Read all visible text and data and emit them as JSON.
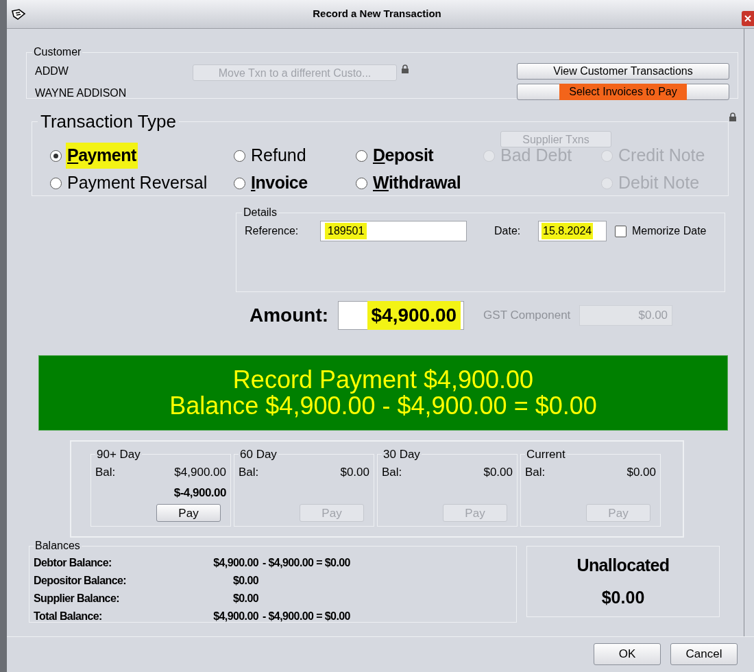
{
  "window": {
    "title": "Record a New Transaction"
  },
  "customer": {
    "legend": "Customer",
    "code": "ADDW",
    "name": "WAYNE ADDISON",
    "move_button": {
      "label": "Move Txn to a different Custo...",
      "disabled": true
    },
    "buttons": [
      {
        "label": "View Customer Transactions",
        "highlighted": false
      },
      {
        "label": "Select Invoices to Pay",
        "highlighted": true
      }
    ]
  },
  "transaction_type": {
    "legend": "Transaction Type",
    "supplier_button": {
      "label": "Supplier Txns",
      "disabled": true
    },
    "columns": [
      [
        {
          "label": "Payment",
          "selected": true,
          "disabled": false,
          "bold": true,
          "accel": true,
          "highlighted": true
        },
        {
          "label": "Payment Reversal",
          "selected": false,
          "disabled": false,
          "bold": false,
          "accel": false,
          "highlighted": false
        }
      ],
      [
        {
          "label": "Refund",
          "selected": false,
          "disabled": false,
          "bold": false,
          "accel": false,
          "highlighted": false
        },
        {
          "label": "Invoice",
          "selected": false,
          "disabled": false,
          "bold": true,
          "accel": true,
          "highlighted": false
        }
      ],
      [
        {
          "label": "Deposit",
          "selected": false,
          "disabled": false,
          "bold": true,
          "accel": true,
          "highlighted": false
        },
        {
          "label": "Withdrawal",
          "selected": false,
          "disabled": false,
          "bold": true,
          "accel": true,
          "highlighted": false
        }
      ],
      [
        {
          "label": "Bad Debt",
          "selected": false,
          "disabled": true,
          "bold": false,
          "accel": false,
          "highlighted": false
        }
      ],
      [
        {
          "label": "Credit Note",
          "selected": false,
          "disabled": true,
          "bold": false,
          "accel": false,
          "highlighted": false
        },
        {
          "label": "Debit Note",
          "selected": false,
          "disabled": true,
          "bold": false,
          "accel": false,
          "highlighted": false
        }
      ]
    ]
  },
  "details": {
    "legend": "Details",
    "reference_label": "Reference:",
    "reference": "189501",
    "date_label": "Date:",
    "date": "15.8.2024",
    "memorize": {
      "label": "Memorize Date",
      "checked": false
    }
  },
  "amount": {
    "label": "Amount:",
    "value": "$4,900.00",
    "gst_label": "GST Component",
    "gst_value": "$0.00"
  },
  "banner": {
    "line1": "Record Payment $4,900.00",
    "line2": "Balance $4,900.00 - $4,900.00 = $0.00"
  },
  "aging": [
    {
      "title": "90+ Day",
      "bal_label": "Bal:",
      "balance": "$4,900.00",
      "allocated": "$-4,900.00",
      "pay": {
        "label": "Pay",
        "disabled": false
      }
    },
    {
      "title": "60 Day",
      "bal_label": "Bal:",
      "balance": "$0.00",
      "pay": {
        "label": "Pay",
        "disabled": true
      }
    },
    {
      "title": "30 Day",
      "bal_label": "Bal:",
      "balance": "$0.00",
      "pay": {
        "label": "Pay",
        "disabled": true
      }
    },
    {
      "title": "Current",
      "bal_label": "Bal:",
      "balance": "$0.00",
      "pay": {
        "label": "Pay",
        "disabled": true
      }
    }
  ],
  "balances": {
    "legend": "Balances",
    "rows": [
      {
        "label": "Debtor Balance:",
        "value": "$4,900.00",
        "formula": "- $4,900.00 = $0.00"
      },
      {
        "label": "Depositor Balance:",
        "value": "$0.00"
      },
      {
        "label": "Supplier Balance:",
        "value": "$0.00"
      },
      {
        "label": "Total Balance:",
        "value": "$4,900.00",
        "formula": "- $4,900.00 = $0.00"
      }
    ]
  },
  "unallocated": {
    "label": "Unallocated",
    "value": "$0.00"
  },
  "buttons": [
    "OK",
    "Cancel"
  ]
}
